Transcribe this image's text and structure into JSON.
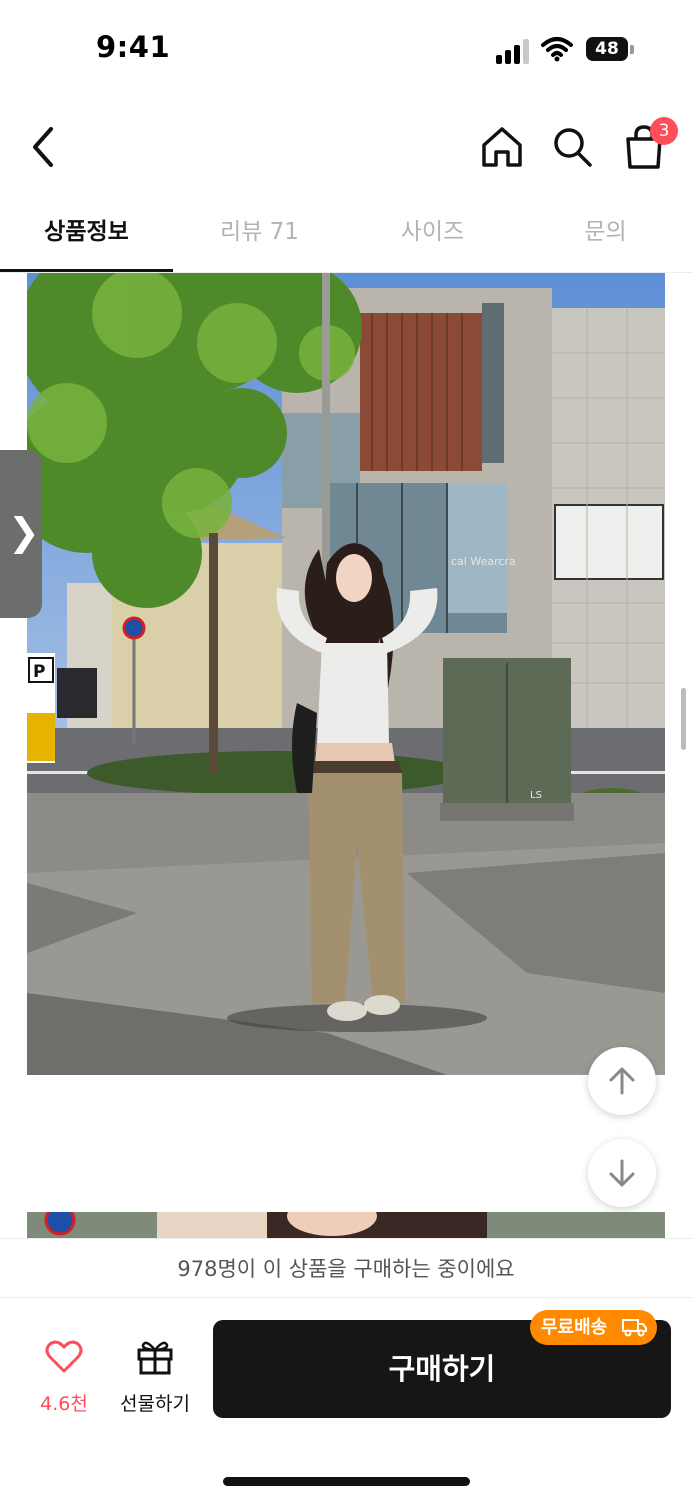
{
  "status_bar": {
    "time": "9:41",
    "battery": "48"
  },
  "nav": {
    "cart_count": "3"
  },
  "tabs": [
    {
      "label": "상품정보",
      "active": true
    },
    {
      "label": "리뷰 71",
      "active": false
    },
    {
      "label": "사이즈",
      "active": false
    },
    {
      "label": "문의",
      "active": false
    }
  ],
  "image": {
    "store_sign": "cal Wearcra",
    "parking_sign": "P",
    "box_label": "LS"
  },
  "side_handle": {
    "icon": "chevron-right-icon"
  },
  "buyers_bar": {
    "text": "978명이 이 상품을 구매하는 중이에요"
  },
  "bottom": {
    "like_count": "4.6천",
    "gift_label": "선물하기",
    "buy_label": "구매하기",
    "free_shipping_label": "무료배송"
  },
  "colors": {
    "accent": "#ff4d5a",
    "badge_orange": "#ff8a00",
    "buy_button": "#161616"
  }
}
